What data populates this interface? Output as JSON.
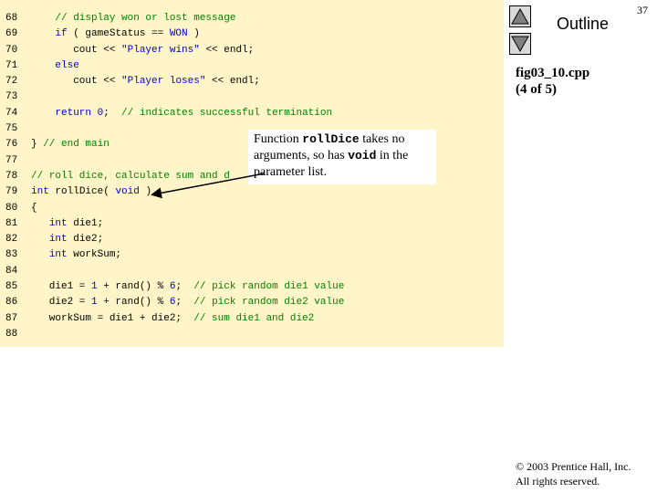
{
  "sidebar": {
    "title": "Outline",
    "page_number": "37",
    "figure_name": "fig03_10.cpp",
    "figure_page": "(4 of 5)",
    "up_icon": "triangle-up",
    "down_icon": "triangle-down"
  },
  "callout": {
    "pre": "Function ",
    "func": "rollDice",
    "mid1": " takes no arguments, so has ",
    "void": "void",
    "post": " in the parameter list."
  },
  "footer": {
    "copyright": "© 2003 Prentice Hall, Inc.",
    "rights": "All rights reserved."
  },
  "code_lines": [
    {
      "n": "68",
      "parts": [
        {
          "t": "    ",
          "c": ""
        },
        {
          "t": "// display won or lost message",
          "c": "cm"
        }
      ]
    },
    {
      "n": "69",
      "parts": [
        {
          "t": "    ",
          "c": ""
        },
        {
          "t": "if",
          "c": "kw"
        },
        {
          "t": " ( gameStatus == ",
          "c": ""
        },
        {
          "t": "WON",
          "c": "kw"
        },
        {
          "t": " )",
          "c": ""
        }
      ]
    },
    {
      "n": "70",
      "parts": [
        {
          "t": "       cout << ",
          "c": ""
        },
        {
          "t": "\"Player wins\"",
          "c": "st"
        },
        {
          "t": " << endl;",
          "c": ""
        }
      ]
    },
    {
      "n": "71",
      "parts": [
        {
          "t": "    ",
          "c": ""
        },
        {
          "t": "else",
          "c": "kw"
        }
      ]
    },
    {
      "n": "72",
      "parts": [
        {
          "t": "       cout << ",
          "c": ""
        },
        {
          "t": "\"Player loses\"",
          "c": "st"
        },
        {
          "t": " << endl;",
          "c": ""
        }
      ]
    },
    {
      "n": "73",
      "parts": []
    },
    {
      "n": "74",
      "parts": [
        {
          "t": "    ",
          "c": ""
        },
        {
          "t": "return",
          "c": "kw"
        },
        {
          "t": " ",
          "c": ""
        },
        {
          "t": "0",
          "c": "num"
        },
        {
          "t": ";  ",
          "c": ""
        },
        {
          "t": "// indicates successful termination",
          "c": "cm"
        }
      ]
    },
    {
      "n": "75",
      "parts": []
    },
    {
      "n": "76",
      "parts": [
        {
          "t": "} ",
          "c": ""
        },
        {
          "t": "// end main",
          "c": "cm"
        }
      ]
    },
    {
      "n": "77",
      "parts": []
    },
    {
      "n": "78",
      "parts": [
        {
          "t": "// roll dice, calculate sum and d",
          "c": "cm"
        }
      ]
    },
    {
      "n": "79",
      "parts": [
        {
          "t": "int",
          "c": "kw"
        },
        {
          "t": " rollDice( ",
          "c": ""
        },
        {
          "t": "void",
          "c": "kw"
        },
        {
          "t": " )",
          "c": ""
        }
      ]
    },
    {
      "n": "80",
      "parts": [
        {
          "t": "{",
          "c": ""
        }
      ]
    },
    {
      "n": "81",
      "parts": [
        {
          "t": "   ",
          "c": ""
        },
        {
          "t": "int",
          "c": "kw"
        },
        {
          "t": " die1;",
          "c": ""
        }
      ]
    },
    {
      "n": "82",
      "parts": [
        {
          "t": "   ",
          "c": ""
        },
        {
          "t": "int",
          "c": "kw"
        },
        {
          "t": " die2;",
          "c": ""
        }
      ]
    },
    {
      "n": "83",
      "parts": [
        {
          "t": "   ",
          "c": ""
        },
        {
          "t": "int",
          "c": "kw"
        },
        {
          "t": " workSum;",
          "c": ""
        }
      ]
    },
    {
      "n": "84",
      "parts": []
    },
    {
      "n": "85",
      "parts": [
        {
          "t": "   die1 = ",
          "c": ""
        },
        {
          "t": "1",
          "c": "num"
        },
        {
          "t": " + rand() % ",
          "c": ""
        },
        {
          "t": "6",
          "c": "num"
        },
        {
          "t": ";  ",
          "c": ""
        },
        {
          "t": "// pick random die1 value",
          "c": "cm"
        }
      ]
    },
    {
      "n": "86",
      "parts": [
        {
          "t": "   die2 = ",
          "c": ""
        },
        {
          "t": "1",
          "c": "num"
        },
        {
          "t": " + rand() % ",
          "c": ""
        },
        {
          "t": "6",
          "c": "num"
        },
        {
          "t": ";  ",
          "c": ""
        },
        {
          "t": "// pick random die2 value",
          "c": "cm"
        }
      ]
    },
    {
      "n": "87",
      "parts": [
        {
          "t": "   workSum = die1 + die2;  ",
          "c": ""
        },
        {
          "t": "// sum die1 and die2",
          "c": "cm"
        }
      ]
    },
    {
      "n": "88",
      "parts": []
    }
  ]
}
